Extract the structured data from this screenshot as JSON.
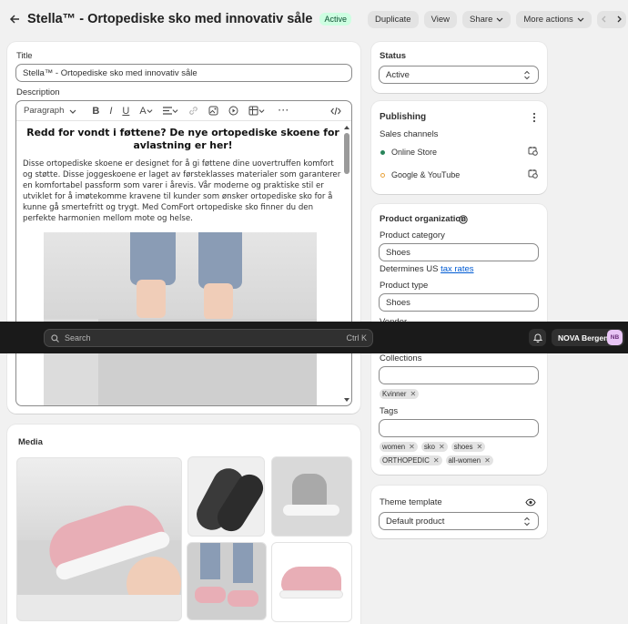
{
  "header": {
    "title": "Stella™ - Ortopediske sko med innovativ såle",
    "status_badge": "Active",
    "buttons": {
      "duplicate": "Duplicate",
      "view": "View",
      "share": "Share",
      "more": "More actions"
    }
  },
  "main": {
    "title_label": "Title",
    "title_value": "Stella™ - Ortopediske sko med innovativ såle",
    "description_label": "Description",
    "toolbar": {
      "paragraph": "Paragraph"
    },
    "content_heading": "Redd for vondt i føttene? De nye ortopediske skoene for avlastning er her!",
    "content_body": "Disse ortopediske skoene er designet for å gi føttene dine uovertruffen komfort og støtte. Disse joggeskoene er laget av førsteklasses materialer som garanterer en komfortabel passform som varer i årevis. Vår moderne og praktiske stil er utviklet for å imøtekomme kravene til kunder som ønsker ortopediske sko for å kunne gå smertefritt og trygt. Med ComFort ortopediske sko finner du den perfekte harmonien mellom mote og helse."
  },
  "media": {
    "label": "Media"
  },
  "status_card": {
    "label": "Status",
    "value": "Active"
  },
  "publishing": {
    "title": "Publishing",
    "sales_channels_label": "Sales channels",
    "channels": [
      {
        "name": "Online Store",
        "color": "#29845a"
      },
      {
        "name": "Google & YouTube",
        "color": "#e8a33d"
      }
    ]
  },
  "organization": {
    "title": "Product organization",
    "category_label": "Product category",
    "category_value": "Shoes",
    "determines_text": "Determines US",
    "tax_link": "tax rates",
    "type_label": "Product type",
    "type_value": "Shoes",
    "vendor_label": "Vendor",
    "collections_label": "Collections",
    "collections": [
      "Kvinner"
    ],
    "tags_label": "Tags",
    "tags_row1": [
      "women",
      "sko",
      "shoes"
    ],
    "tags_row2": [
      "ORTHOPEDIC",
      "all-women"
    ]
  },
  "theme": {
    "label": "Theme template",
    "value": "Default product"
  },
  "topbar": {
    "search_placeholder": "Search",
    "shortcut": "Ctrl K",
    "store_name": "NOVA Bergen",
    "avatar_initials": "NB"
  },
  "colors": {
    "accent": "#005bd3",
    "badge_bg": "#cdfee1",
    "topbar_bg": "#1a1a1a",
    "shoe_pink": "#e8aeb6"
  }
}
